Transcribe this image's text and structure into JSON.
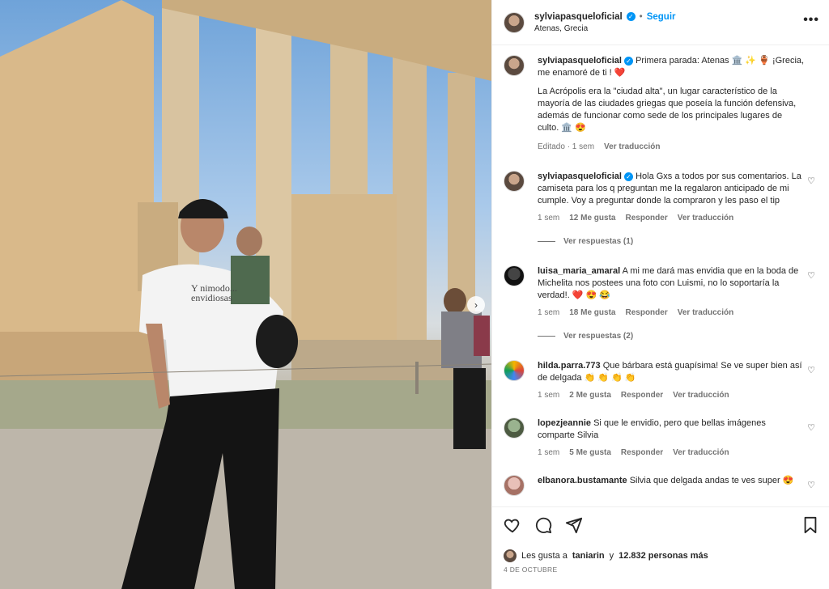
{
  "post": {
    "username": "sylviapasqueloficial",
    "follow_label": "Seguir",
    "location": "Atenas, Grecia",
    "more_label": "•••",
    "next_label": "›"
  },
  "caption": {
    "username": "sylviapasqueloficial",
    "text_1": "Primera parada: Atenas 🏛️ ✨ 🏺 ¡Grecia, me enamoré de ti ! ❤️",
    "text_2": "La Acrópolis era la \"ciudad alta\", un lugar característico de la mayoría de las ciudades griegas que poseía la función defensiva, además de funcionar como sede de los principales lugares de culto. 🏛️ 😍",
    "edited": "Editado · 1 sem",
    "translate": "Ver traducción"
  },
  "comments": [
    {
      "username": "sylviapasqueloficial",
      "verified": true,
      "text": "Hola Gxs a todos por sus comentarios. La camiseta para los q preguntan me la regalaron anticipado de mi cumple. Voy a preguntar donde la compraron y les paso el tip",
      "time": "1 sem",
      "likes": "12 Me gusta",
      "reply": "Responder",
      "translate": "Ver traducción",
      "replies": "Ver respuestas (1)"
    },
    {
      "username": "luisa_maria_amaral",
      "verified": false,
      "text": "A mi me dará mas envidia que en la boda de Michelita nos postees una foto con Luismi, no lo soportaría la verdad!. ❤️ 😍 😂",
      "time": "1 sem",
      "likes": "18 Me gusta",
      "reply": "Responder",
      "translate": "Ver traducción",
      "replies": "Ver respuestas (2)"
    },
    {
      "username": "hilda.parra.773",
      "verified": false,
      "text": "Que bárbara está guapísima! Se ve super bien así de delgada 👏 👏 👏 👏",
      "time": "1 sem",
      "likes": "2 Me gusta",
      "reply": "Responder",
      "translate": "Ver traducción"
    },
    {
      "username": "lopezjeannie",
      "verified": false,
      "text": "Si que le envidio, pero que bellas imágenes comparte Silvia",
      "time": "1 sem",
      "likes": "5 Me gusta",
      "reply": "Responder",
      "translate": "Ver traducción"
    },
    {
      "username": "elbanora.bustamante",
      "verified": false,
      "text": "Silvia que delgada andas te ves super 😍"
    }
  ],
  "footer": {
    "likes_prefix": "Les gusta a",
    "likes_user": "taniarin",
    "likes_mid": "y",
    "likes_count": "12.832 personas más",
    "date": "4 DE OCTUBRE"
  },
  "photo": {
    "shirt_text": "Y nimodo... envidiosas"
  }
}
